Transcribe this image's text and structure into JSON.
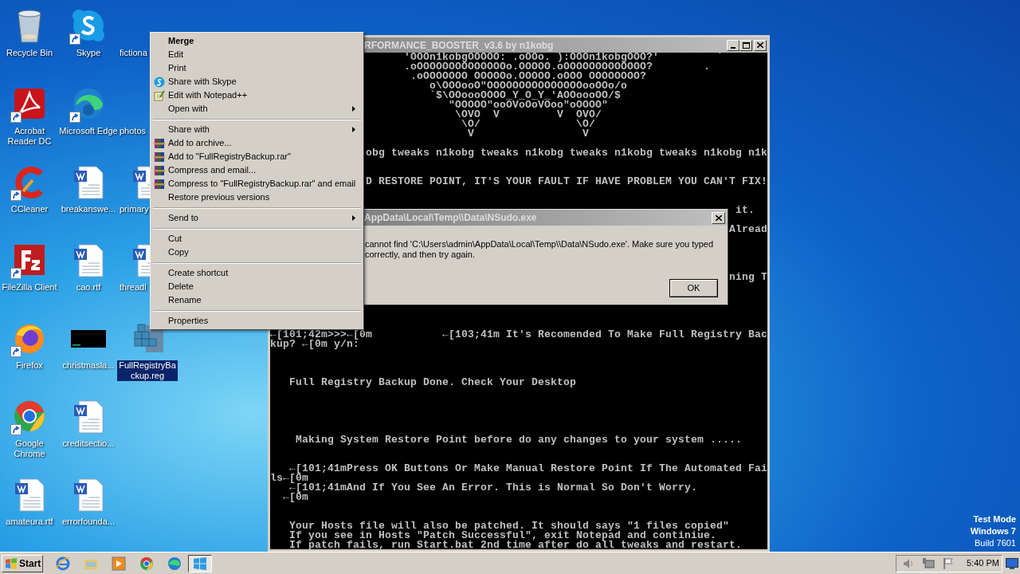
{
  "desktop_icons": [
    {
      "kind": "recycle-bin",
      "label_lines": [
        "Recycle Bin"
      ],
      "shortcut": false,
      "selected": false,
      "clipped": false
    },
    {
      "kind": "acrobat",
      "label_lines": [
        "Acrobat",
        "Reader DC"
      ],
      "shortcut": true,
      "selected": false,
      "clipped": false
    },
    {
      "kind": "ccleaner",
      "label_lines": [
        "CCleaner"
      ],
      "shortcut": true,
      "selected": false,
      "clipped": false
    },
    {
      "kind": "filezilla",
      "label_lines": [
        "FileZilla Client"
      ],
      "shortcut": true,
      "selected": false,
      "clipped": false
    },
    {
      "kind": "firefox",
      "label_lines": [
        "Firefox"
      ],
      "shortcut": true,
      "selected": false,
      "clipped": false
    },
    {
      "kind": "chrome",
      "label_lines": [
        "Google",
        "Chrome"
      ],
      "shortcut": true,
      "selected": false,
      "clipped": false
    },
    {
      "kind": "word",
      "label_lines": [
        "amateura.rtf"
      ],
      "shortcut": false,
      "selected": false,
      "clipped": false
    },
    {
      "kind": "skype",
      "label_lines": [
        "Skype"
      ],
      "shortcut": true,
      "selected": false,
      "clipped": false
    },
    {
      "kind": "edge",
      "label_lines": [
        "Microsoft Edge"
      ],
      "shortcut": true,
      "selected": false,
      "clipped": false
    },
    {
      "kind": "word",
      "label_lines": [
        "breakanswe..."
      ],
      "shortcut": false,
      "selected": false,
      "clipped": false
    },
    {
      "kind": "word",
      "label_lines": [
        "cao.rtf"
      ],
      "shortcut": false,
      "selected": false,
      "clipped": false
    },
    {
      "kind": "console",
      "label_lines": [
        "christmasla..."
      ],
      "shortcut": false,
      "selected": false,
      "clipped": false
    },
    {
      "kind": "word",
      "label_lines": [
        "creditsectio..."
      ],
      "shortcut": false,
      "selected": false,
      "clipped": false
    },
    {
      "kind": "word",
      "label_lines": [
        "errorfounda..."
      ],
      "shortcut": false,
      "selected": false,
      "clipped": false
    },
    {
      "kind": "hidden",
      "label_lines": [
        "fictiona"
      ],
      "shortcut": false,
      "selected": false,
      "clipped": true
    },
    {
      "kind": "hidden",
      "label_lines": [
        "photos"
      ],
      "shortcut": false,
      "selected": false,
      "clipped": true
    },
    {
      "kind": "word",
      "label_lines": [
        "primary"
      ],
      "shortcut": false,
      "selected": false,
      "clipped": true
    },
    {
      "kind": "word",
      "label_lines": [
        "threadl"
      ],
      "shortcut": false,
      "selected": false,
      "clipped": true
    },
    {
      "kind": "registry",
      "label_lines": [
        "FullRegistryBa",
        "ckup.reg"
      ],
      "shortcut": false,
      "selected": true,
      "clipped": false
    }
  ],
  "console": {
    "title": "RFORMANCE_BOOSTER_v3.6 by n1kobg",
    "lines": [
      {
        "kind": "text",
        "text": "                     'OOOn1kobgOOOOO: .oOOo. ):OOOn1kobgOOO?'         `"
      },
      {
        "kind": "text",
        "text": "                     .oOOOOOOOOOOOOOOo.OOOOO.oOOOOOOOOOOOOO?        ."
      },
      {
        "kind": "text",
        "text": "                      .oOOOOOOO OOOOOo.OOOOO.oOOO OOOOOOOO?"
      },
      {
        "kind": "text",
        "text": "                         o\\OOOooO\"OOOOOOOOOOOOOOOooOOo/o"
      },
      {
        "kind": "text",
        "text": "                         `$\\OOoooOOOO_Y_O_Y_'AOOoooOO/$"
      },
      {
        "kind": "text",
        "text": "                            \"OOOOO\"ooOVoOoVOoo\"oOOOO\""
      },
      {
        "kind": "text",
        "text": "                             \\OVO  V         V  OVO/"
      },
      {
        "kind": "text",
        "text": "                              \\O/               \\O/"
      },
      {
        "kind": "text",
        "text": "                               V                 V"
      },
      {
        "kind": "blank"
      },
      {
        "kind": "text",
        "text": "               obg tweaks n1kobg tweaks n1kobg tweaks n1kobg tweaks n1kobg n1k"
      },
      {
        "kind": "blank"
      },
      {
        "kind": "blank"
      },
      {
        "kind": "text",
        "text": "               D RESTORE POINT, IT'S YOUR FAULT IF HAVE PROBLEM YOU CAN'T FIX!"
      },
      {
        "kind": "blank"
      },
      {
        "kind": "blank"
      },
      {
        "kind": "text",
        "text": "                                                                         it."
      },
      {
        "kind": "blank"
      },
      {
        "kind": "text",
        "text": "                                                                        Alread"
      },
      {
        "kind": "blank"
      },
      {
        "kind": "blank"
      },
      {
        "kind": "blank"
      },
      {
        "kind": "blank"
      },
      {
        "kind": "text",
        "text": "                                                                        ning T"
      },
      {
        "kind": "blank"
      },
      {
        "kind": "blank"
      },
      {
        "kind": "blank"
      },
      {
        "kind": "blank"
      },
      {
        "kind": "blank"
      },
      {
        "kind": "text",
        "text": "←[101;42m>>>←[0m           ←[103;41m It's Recomended To Make Full Registry Bac"
      },
      {
        "kind": "text",
        "text": "kup? ←[0m y/n:"
      },
      {
        "kind": "blank"
      },
      {
        "kind": "blank"
      },
      {
        "kind": "blank"
      },
      {
        "kind": "text",
        "text": "   Full Registry Backup Done. Check Your Desktop"
      },
      {
        "kind": "blank"
      },
      {
        "kind": "blank"
      },
      {
        "kind": "blank"
      },
      {
        "kind": "blank"
      },
      {
        "kind": "blank"
      },
      {
        "kind": "text",
        "text": "    Making System Restore Point before do any changes to your system ....."
      },
      {
        "kind": "blank"
      },
      {
        "kind": "blank"
      },
      {
        "kind": "text",
        "text": "   ←[101;41mPress OK Buttons Or Make Manual Restore Point If The Automated Fai"
      },
      {
        "kind": "text",
        "text": "ls←[0m"
      },
      {
        "kind": "text",
        "text": "   ←[101;41mAnd If You See An Error. This is Normal So Don't Worry."
      },
      {
        "kind": "text",
        "text": "  ←[0m"
      },
      {
        "kind": "blank"
      },
      {
        "kind": "blank"
      },
      {
        "kind": "text",
        "text": "   Your Hosts file will also be patched. It should says \"1 files copied\""
      },
      {
        "kind": "text",
        "text": "   If you see in Hosts \"Patch Successful\", exit Notepad and continiue."
      },
      {
        "kind": "text",
        "text": "   If patch fails, run Start.bat 2nd time after do all tweaks and restart."
      }
    ]
  },
  "dialog": {
    "title": "AppData\\Local\\Temp\\\\Data\\NSudo.exe",
    "message_lines": [
      "cannot find 'C:\\Users\\admin\\AppData\\Local\\Temp\\\\Data\\NSudo.exe'. Make sure you typed",
      "correctly, and then try again."
    ],
    "button": "OK"
  },
  "context_menu": {
    "groups": [
      [
        {
          "kind": "plain",
          "label": "Merge",
          "default": true,
          "submenu": false
        },
        {
          "kind": "plain",
          "label": "Edit",
          "default": false,
          "submenu": false
        },
        {
          "kind": "plain",
          "label": "Print",
          "default": false,
          "submenu": false
        },
        {
          "kind": "skype",
          "label": "Share with Skype",
          "default": false,
          "submenu": false
        },
        {
          "kind": "notepad",
          "label": "Edit with Notepad++",
          "default": false,
          "submenu": false
        },
        {
          "kind": "plain",
          "label": "Open with",
          "default": false,
          "submenu": true
        }
      ],
      [
        {
          "kind": "plain",
          "label": "Share with",
          "default": false,
          "submenu": true
        },
        {
          "kind": "winrar",
          "label": "Add to archive...",
          "default": false,
          "submenu": false
        },
        {
          "kind": "winrar",
          "label": "Add to \"FullRegistryBackup.rar\"",
          "default": false,
          "submenu": false
        },
        {
          "kind": "winrar",
          "label": "Compress and email...",
          "default": false,
          "submenu": false
        },
        {
          "kind": "winrar",
          "label": "Compress to \"FullRegistryBackup.rar\" and email",
          "default": false,
          "submenu": false
        },
        {
          "kind": "plain",
          "label": "Restore previous versions",
          "default": false,
          "submenu": false
        }
      ],
      [
        {
          "kind": "plain",
          "label": "Send to",
          "default": false,
          "submenu": true
        }
      ],
      [
        {
          "kind": "plain",
          "label": "Cut",
          "default": false,
          "submenu": false
        },
        {
          "kind": "plain",
          "label": "Copy",
          "default": false,
          "submenu": false
        }
      ],
      [
        {
          "kind": "plain",
          "label": "Create shortcut",
          "default": false,
          "submenu": false
        },
        {
          "kind": "plain",
          "label": "Delete",
          "default": false,
          "submenu": false
        },
        {
          "kind": "plain",
          "label": "Rename",
          "default": false,
          "submenu": false
        }
      ],
      [
        {
          "kind": "plain",
          "label": "Properties",
          "default": false,
          "submenu": false
        }
      ]
    ]
  },
  "taskbar": {
    "start": "Start",
    "task_button": {
      "pressed": true
    },
    "clock": "5:40 PM"
  },
  "watermark": [
    {
      "text": "Test Mode",
      "bold": true
    },
    {
      "text": "Windows 7",
      "bold": true
    },
    {
      "text": "Build 7601",
      "bold": false
    }
  ]
}
